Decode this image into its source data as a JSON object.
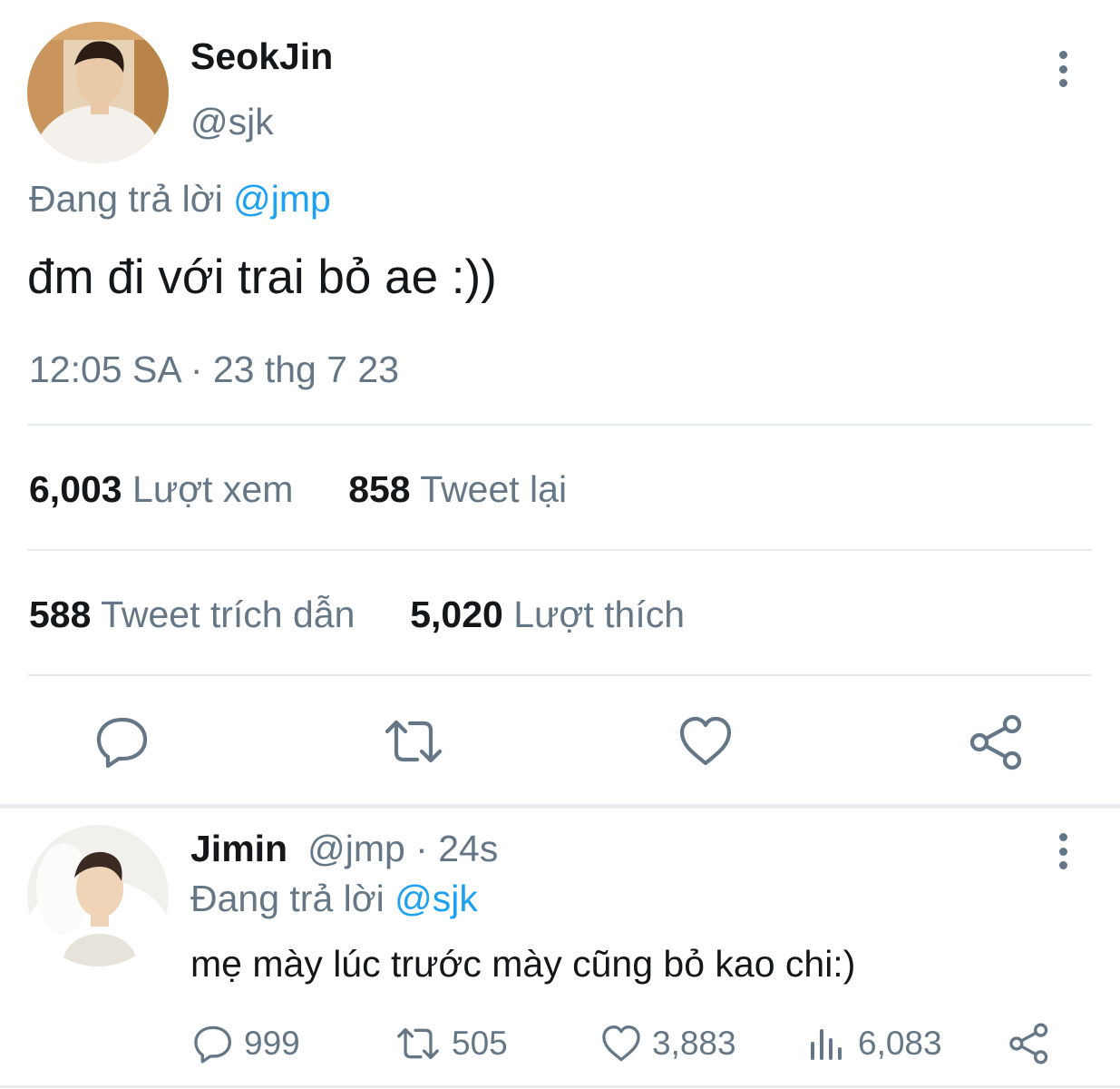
{
  "main_tweet": {
    "author_name": "SeokJin",
    "author_handle": "@sjk",
    "reply_prefix": "Đang trả lời ",
    "reply_mention": "@jmp",
    "text": "đm đi với trai bỏ ae :))",
    "timestamp": "12:05 SA · 23 thg 7 23",
    "stats": {
      "views_count": "6,003",
      "views_label": "Lượt xem",
      "retweets_count": "858",
      "retweets_label": "Tweet lại",
      "quotes_count": "588",
      "quotes_label": "Tweet trích dẫn",
      "likes_count": "5,020",
      "likes_label": "Lượt thích"
    },
    "actions": [
      "reply-icon",
      "retweet-icon",
      "like-icon",
      "share-icon"
    ]
  },
  "reply_tweet": {
    "author_name": "Jimin",
    "meta": "@jmp · 24s",
    "reply_prefix": "Đang trả lời ",
    "reply_mention": "@sjk",
    "text": "mẹ mày lúc trước mày cũng bỏ kao chi:)",
    "reply_count": "999",
    "retweet_count": "505",
    "like_count": "3,883",
    "view_count": "6,083"
  },
  "colors": {
    "text_primary": "#14171a",
    "text_secondary": "#657786",
    "accent": "#1da1f2",
    "divider": "#e6ecf0"
  }
}
